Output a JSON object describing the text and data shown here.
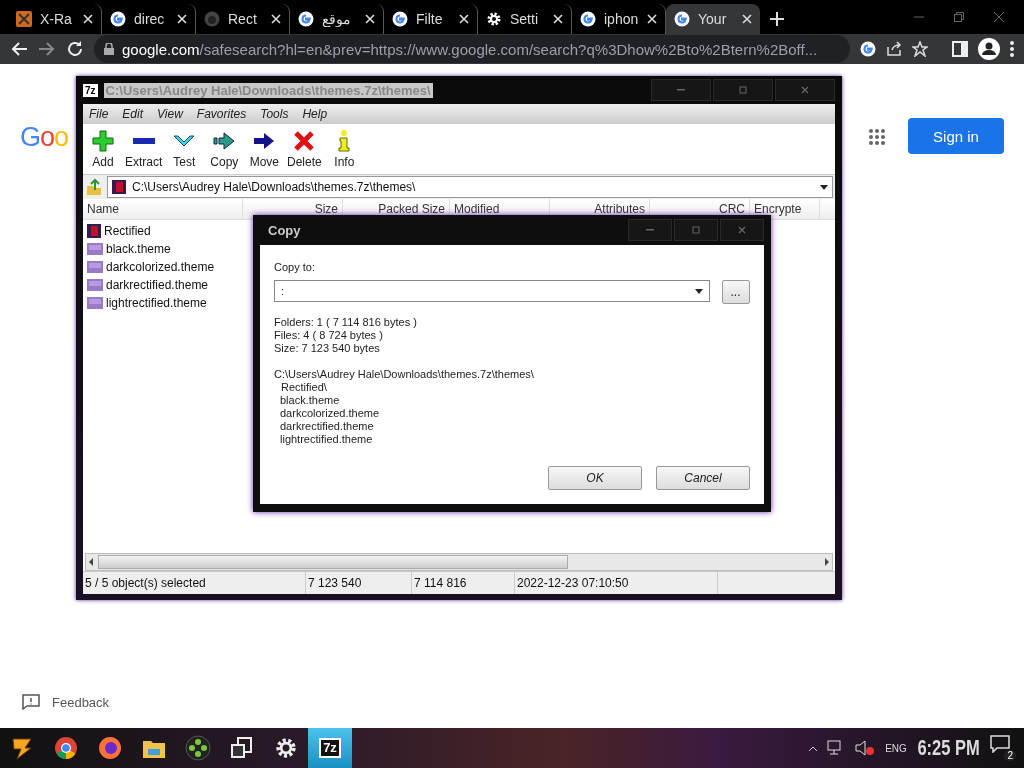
{
  "browser": {
    "tabs": [
      {
        "title": "X-Ra",
        "kind": "xray",
        "selected": false
      },
      {
        "title": "direc",
        "kind": "google",
        "selected": false
      },
      {
        "title": "Rect",
        "kind": "github",
        "selected": false
      },
      {
        "title": "موقع",
        "kind": "google",
        "selected": false
      },
      {
        "title": "Filte",
        "kind": "google",
        "selected": false
      },
      {
        "title": "Setti",
        "kind": "gear",
        "selected": false
      },
      {
        "title": "iphon",
        "kind": "google",
        "selected": false
      },
      {
        "title": "Your",
        "kind": "google",
        "selected": true
      }
    ],
    "address": {
      "host": "google.com",
      "path": "/safesearch?hl=en&prev=https://www.google.com/search?q%3Dhow%2Bto%2Btern%2Boff..."
    }
  },
  "google_page": {
    "logo": "Goo",
    "sign_in": "Sign in",
    "feedback": "Feedback"
  },
  "archive_window": {
    "title": "C:\\Users\\Audrey Hale\\Downloads\\themes.7z\\themes\\",
    "app_label": "7z",
    "menu": [
      "File",
      "Edit",
      "View",
      "Favorites",
      "Tools",
      "Help"
    ],
    "toolbar": [
      {
        "label": "Add",
        "kind": "add"
      },
      {
        "label": "Extract",
        "kind": "extract"
      },
      {
        "label": "Test",
        "kind": "test"
      },
      {
        "label": "Copy",
        "kind": "copy"
      },
      {
        "label": "Move",
        "kind": "move"
      },
      {
        "label": "Delete",
        "kind": "delete"
      },
      {
        "label": "Info",
        "kind": "info"
      }
    ],
    "path": "C:\\Users\\Audrey Hale\\Downloads\\themes.7z\\themes\\",
    "columns": [
      "Name",
      "Size",
      "Packed Size",
      "Modified",
      "Attributes",
      "CRC",
      "Encrypte"
    ],
    "files": [
      {
        "name": "Rectified",
        "kind": "folder"
      },
      {
        "name": "black.theme",
        "kind": "file"
      },
      {
        "name": "darkcolorized.theme",
        "kind": "file"
      },
      {
        "name": "darkrectified.theme",
        "kind": "file"
      },
      {
        "name": "lightrectified.theme",
        "kind": "file"
      }
    ],
    "status_bar": [
      "5 / 5 object(s) selected",
      "7 123 540",
      "7 114 816",
      "2022-12-23 07:10:50"
    ]
  },
  "copy_dialog": {
    "title": "Copy",
    "copy_to_label": "Copy to:",
    "destination": ":",
    "browse": "...",
    "info": [
      "Folders: 1    ( 7 114 816 bytes )",
      "Files: 4    ( 8 724 bytes )",
      "Size: 7 123 540 bytes"
    ],
    "source": "C:\\Users\\Audrey Hale\\Downloads\\themes.7z\\themes\\",
    "items": [
      "Rectified\\",
      "black.theme",
      "darkcolorized.theme",
      "darkrectified.theme",
      "lightrectified.theme"
    ],
    "buttons": [
      "OK",
      "Cancel"
    ]
  },
  "taskbar": {
    "apps": [
      {
        "kind": "launcher",
        "active": false
      },
      {
        "kind": "chrome",
        "active": false
      },
      {
        "kind": "firefox",
        "active": false
      },
      {
        "kind": "files",
        "active": false
      },
      {
        "kind": "gamepad",
        "active": false
      },
      {
        "kind": "devices",
        "active": false
      },
      {
        "kind": "settings",
        "active": false
      },
      {
        "kind": "sevenzip",
        "active": true,
        "label": "7z"
      }
    ],
    "language": "ENG",
    "clock": "6:25 PM",
    "notifications": "2"
  }
}
